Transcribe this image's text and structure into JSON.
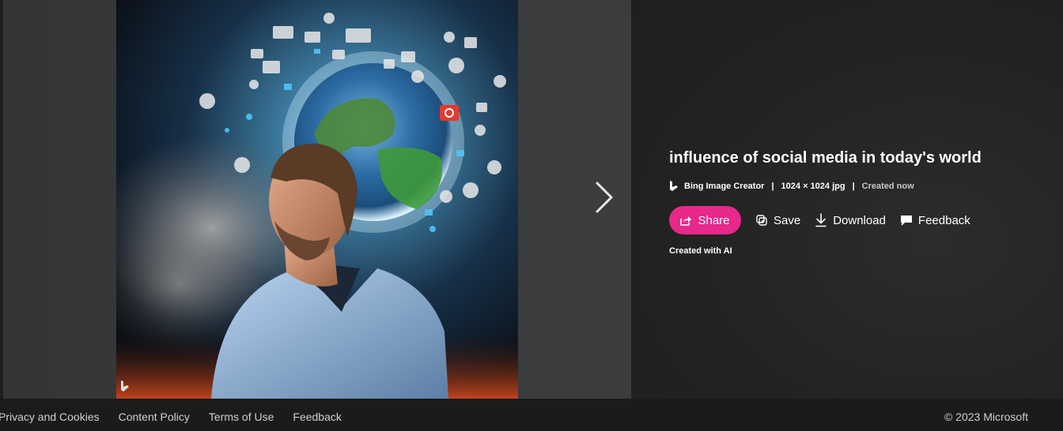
{
  "image": {
    "alt": "influence of social media in today's world",
    "watermark_icon": "bing-b-icon"
  },
  "navigation": {
    "next_icon": "chevron-right-icon"
  },
  "details": {
    "title": "influence of social media in today's world",
    "source": "Bing Image Creator",
    "dimensions": "1024 × 1024 jpg",
    "created": "Created now",
    "separator": "|",
    "created_with": "Created with AI"
  },
  "actions": {
    "share_label": "Share",
    "save_label": "Save",
    "download_label": "Download",
    "feedback_label": "Feedback"
  },
  "footer": {
    "links": [
      "Privacy and Cookies",
      "Content Policy",
      "Terms of Use",
      "Feedback"
    ],
    "copyright": "© 2023 Microsoft"
  },
  "colors": {
    "accent": "#e8288a",
    "background": "#1b1b1b",
    "pane": "#3a3c3e"
  }
}
